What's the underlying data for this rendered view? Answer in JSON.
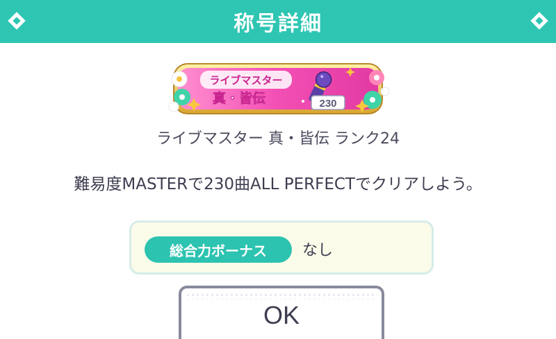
{
  "header": {
    "title": "称号詳細",
    "left_icon": "diamond-icon",
    "right_icon": "diamond-icon"
  },
  "badge": {
    "line1": "ライブマスター",
    "line2": "真・皆伝",
    "count": "230",
    "icon": "microphone-icon"
  },
  "title_name": "ライブマスター 真・皆伝 ランク24",
  "description": "難易度MASTERで230曲ALL PERFECTでクリアしよう。",
  "bonus": {
    "label": "総合力ボーナス",
    "value": "なし"
  },
  "ok_button": {
    "label": "OK"
  },
  "colors": {
    "header": "#2ec6b3",
    "pill": "#2cc3b0",
    "bonus_bg": "#fbfbea",
    "button_border": "#8a8a9e"
  }
}
